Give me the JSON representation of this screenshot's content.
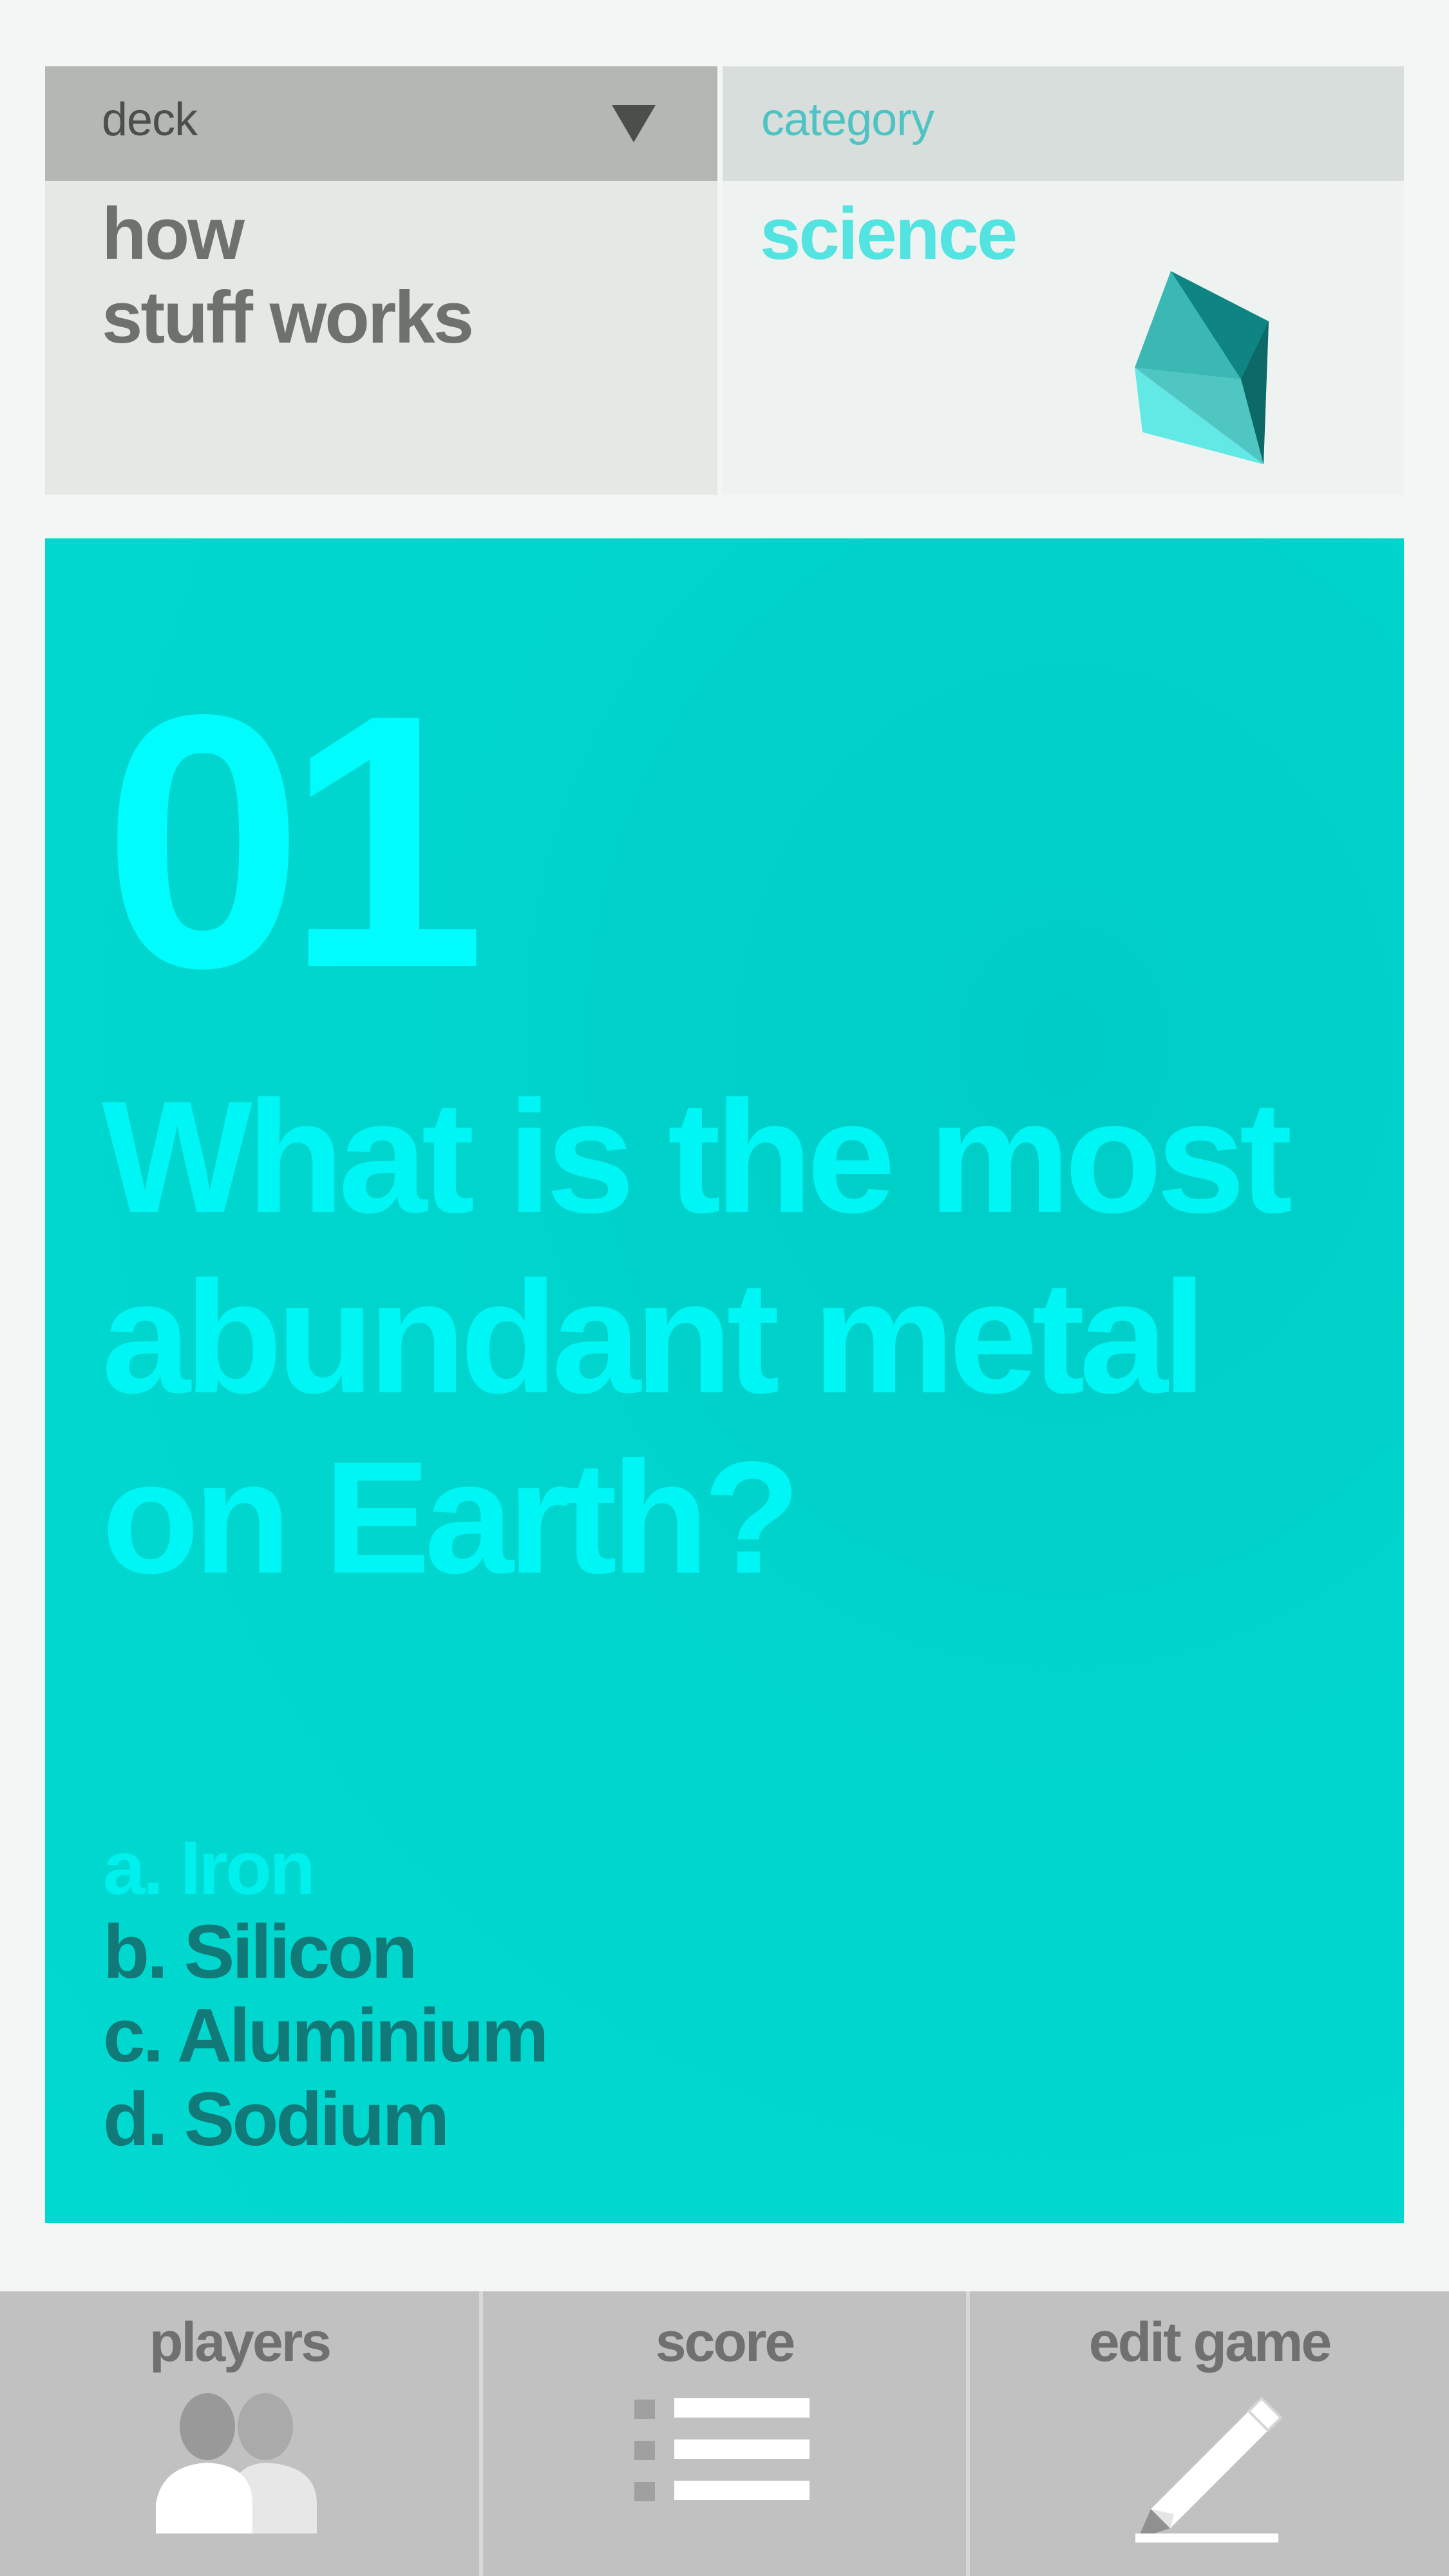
{
  "deck": {
    "label": "deck",
    "name_line1": "how",
    "name_line2": "stuff works",
    "dropdown_icon": "triangle-down-icon"
  },
  "category": {
    "label": "category",
    "name": "science",
    "icon": "crystal-gem-icon"
  },
  "question": {
    "number": "01",
    "text": "What is the most abundant metal on Earth?",
    "answers": [
      {
        "label": "a. Iron",
        "state": "dimmed"
      },
      {
        "label": "b. Silicon",
        "state": "normal"
      },
      {
        "label": "c. Aluminium",
        "state": "normal"
      },
      {
        "label": "d. Sodium",
        "state": "normal"
      }
    ]
  },
  "nav": {
    "players": {
      "label": "players",
      "icon": "players-icon"
    },
    "score": {
      "label": "score",
      "icon": "list-icon"
    },
    "edit_game": {
      "label": "edit game",
      "icon": "pencil-icon"
    }
  },
  "colors": {
    "accent": "#00d5cd",
    "question_text": "#00f6f4",
    "answer_text": "#117a78",
    "category_text": "#53e3e1"
  }
}
